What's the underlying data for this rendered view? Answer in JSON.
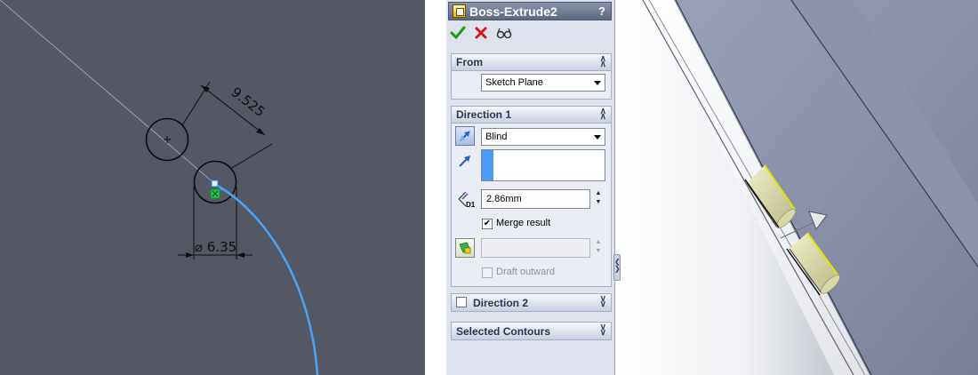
{
  "sketch": {
    "dimension_linear": "9.525",
    "dimension_diameter": "⌀ 6.35"
  },
  "property_manager": {
    "title": "Boss-Extrude2",
    "help_icon": "?",
    "toolbar": {
      "ok_icon": "checkmark-icon",
      "cancel_icon": "x-icon",
      "preview_icon": "eyeglasses-icon"
    },
    "from_group": {
      "label": "From",
      "start_condition": "Sketch Plane"
    },
    "direction1_group": {
      "label": "Direction 1",
      "end_condition": "Blind",
      "depth": "2.86mm",
      "merge_result_label": "Merge result",
      "merge_result_checked": true,
      "draft_outward_label": "Draft outward",
      "draft_outward_checked": false
    },
    "direction2_group": {
      "label": "Direction 2",
      "checked": false
    },
    "selected_contours_group": {
      "label": "Selected Contours"
    },
    "depth_icon_label": "D1"
  },
  "colors": {
    "sketch_background": "#545764",
    "sketch_curve": "#4aa3f5",
    "accent_blue": "#3d8cf0",
    "preview_yellow": "#e4e400"
  }
}
